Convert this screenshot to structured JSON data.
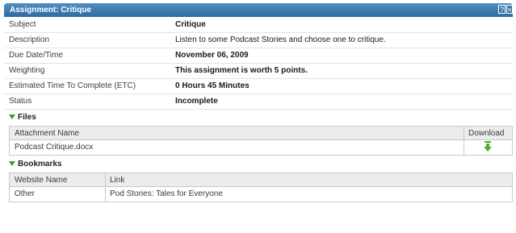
{
  "panel": {
    "title": "Assignment: Critique",
    "help_glyph": "?",
    "close_glyph": "×"
  },
  "details": [
    {
      "label": "Subject",
      "value": "Critique",
      "bold": true
    },
    {
      "label": "Description",
      "value": "Listen to some Podcast Stories and choose one to critique.",
      "bold": false
    },
    {
      "label": "Due Date/Time",
      "value": "November 06, 2009",
      "bold": true
    },
    {
      "label": "Weighting",
      "value": "This assignment is worth 5 points.",
      "bold": true
    },
    {
      "label": "Estimated Time To Complete (ETC)",
      "value": "0 Hours 45 Minutes",
      "bold": true
    },
    {
      "label": "Status",
      "value": "Incomplete",
      "bold": true
    }
  ],
  "files": {
    "heading": "Files",
    "columns": {
      "name": "Attachment Name",
      "download": "Download"
    },
    "rows": [
      {
        "name": "Podcast Critique.docx",
        "download_icon": "download-arrow-icon"
      }
    ]
  },
  "bookmarks": {
    "heading": "Bookmarks",
    "columns": {
      "site": "Website Name",
      "link": "Link"
    },
    "rows": [
      {
        "site": "Other",
        "link": "Pod Stories: Tales for Everyone"
      }
    ]
  },
  "colors": {
    "titlebar": "#2f6aa0",
    "section_arrow": "#3e9a2f",
    "download_icon": "#4caf2e"
  }
}
